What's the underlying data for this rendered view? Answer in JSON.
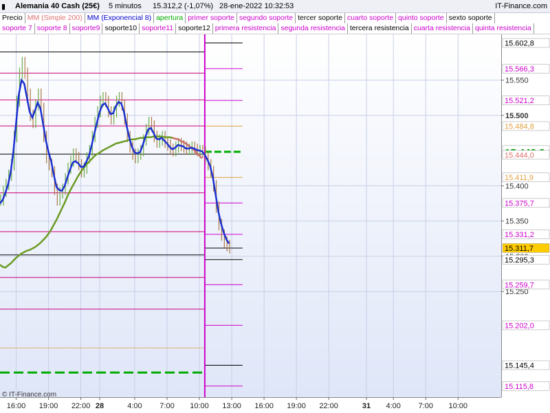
{
  "title_bar": {
    "instrument": "Alemania 40 Cash (25€)",
    "timeframe": "5 minutos",
    "quote": "15.312,2 (-1,07%)",
    "datetime": "28-ene-2022 10:32:53",
    "brand": "IT-Finance.com"
  },
  "legend_row1": [
    {
      "label": "Precio",
      "color": "#000000"
    },
    {
      "label": "MM (Simple 200)",
      "color": "#e07070"
    },
    {
      "label": "MM (Exponencial 8)",
      "color": "#0000cc"
    },
    {
      "label": "apertura",
      "color": "#00aa00"
    },
    {
      "label": "primer soporte",
      "color": "#cc00cc"
    },
    {
      "label": "segundo soporte",
      "color": "#cc00cc"
    },
    {
      "label": "tercer soporte",
      "color": "#000000"
    },
    {
      "label": "cuarto soporte",
      "color": "#cc00cc"
    },
    {
      "label": "quinto soporte",
      "color": "#cc00cc"
    },
    {
      "label": "sexto soporte",
      "color": "#000000"
    }
  ],
  "legend_row2": [
    {
      "label": "soporte 7",
      "color": "#cc00cc"
    },
    {
      "label": "soporte 8",
      "color": "#cc00cc"
    },
    {
      "label": "soporte9",
      "color": "#cc00cc"
    },
    {
      "label": "soporte10",
      "color": "#000000"
    },
    {
      "label": "soporte11",
      "color": "#cc00cc"
    },
    {
      "label": "soporte12",
      "color": "#000000"
    },
    {
      "label": "primera resistencia",
      "color": "#cc00cc"
    },
    {
      "label": "segunda resistencia",
      "color": "#cc00cc"
    },
    {
      "label": "tercera resistencia",
      "color": "#000000"
    },
    {
      "label": "cuarta resistencia",
      "color": "#cc00cc"
    },
    {
      "label": "quinta resistencia",
      "color": "#cc00cc"
    }
  ],
  "credit": "© IT-Finance.com",
  "chart_data": {
    "type": "line",
    "ylim": [
      15100,
      15615
    ],
    "y_ticks": [
      "15.550",
      "15.500",
      "15.400",
      "15.350",
      "15.300",
      "15.250"
    ],
    "x_ticks": [
      {
        "label": "16:00",
        "bar": 6
      },
      {
        "label": "19:00",
        "bar": 18
      },
      {
        "label": "22:00",
        "bar": 30
      },
      {
        "label": "28",
        "bar": 37,
        "bold": true
      },
      {
        "label": "4:00",
        "bar": 50
      },
      {
        "label": "7:00",
        "bar": 62
      },
      {
        "label": "10:00",
        "bar": 74
      },
      {
        "label": "13:00",
        "bar": 86
      },
      {
        "label": "16:00",
        "bar": 98
      },
      {
        "label": "19:00",
        "bar": 110
      },
      {
        "label": "22:00",
        "bar": 122
      },
      {
        "label": "31",
        "bar": 136,
        "bold": true
      },
      {
        "label": "4:00",
        "bar": 146
      },
      {
        "label": "7:00",
        "bar": 158
      },
      {
        "label": "10:00",
        "bar": 170
      }
    ],
    "bars_total": 186,
    "session_break_bar": 76,
    "last_price": 15311.7,
    "price_series": [
      15380,
      15392,
      15402,
      15415,
      15430,
      15470,
      15520,
      15560,
      15575,
      15560,
      15530,
      15500,
      15490,
      15515,
      15530,
      15510,
      15470,
      15440,
      15430,
      15420,
      15395,
      15380,
      15390,
      15395,
      15410,
      15425,
      15435,
      15445,
      15440,
      15430,
      15420,
      15425,
      15440,
      15450,
      15470,
      15490,
      15505,
      15520,
      15525,
      15520,
      15505,
      15495,
      15505,
      15520,
      15525,
      15515,
      15495,
      15470,
      15455,
      15445,
      15440,
      15445,
      15450,
      15465,
      15480,
      15490,
      15485,
      15470,
      15462,
      15465,
      15470,
      15462,
      15458,
      15452,
      15450,
      15455,
      15460,
      15457,
      15455,
      15452,
      15452,
      15455,
      15452,
      15450,
      15450,
      15448,
      15440,
      15430,
      15420,
      15400,
      15370,
      15345,
      15330,
      15320,
      15315,
      15312
    ],
    "ema8_series": [
      15375,
      15380,
      15390,
      15402,
      15420,
      15450,
      15490,
      15530,
      15550,
      15545,
      15525,
      15505,
      15497,
      15507,
      15518,
      15510,
      15488,
      15465,
      15448,
      15435,
      15415,
      15398,
      15394,
      15393,
      15400,
      15412,
      15423,
      15433,
      15435,
      15432,
      15427,
      15427,
      15434,
      15442,
      15457,
      15474,
      15490,
      15505,
      15515,
      15517,
      15510,
      15502,
      15503,
      15513,
      15519,
      15517,
      15505,
      15485,
      15468,
      15455,
      15447,
      15446,
      15448,
      15458,
      15470,
      15480,
      15482,
      15475,
      15467,
      15466,
      15468,
      15464,
      15460,
      15455,
      15452,
      15454,
      15458,
      15457,
      15456,
      15453,
      15453,
      15454,
      15453,
      15451,
      15450,
      15449,
      15444,
      15437,
      15428,
      15412,
      15388,
      15364,
      15347,
      15334,
      15324,
      15318
    ],
    "sma200_series": [
      15288,
      15285,
      15284,
      15287,
      15290,
      15294,
      15298,
      15301,
      15304,
      15306,
      15308,
      15309,
      15311,
      15313,
      15316,
      15319,
      15323,
      15327,
      15332,
      15338,
      15345,
      15352,
      15360,
      15368,
      15376,
      15385,
      15393,
      15400,
      15407,
      15414,
      15420,
      15425,
      15430,
      15434,
      15438,
      15442,
      15445,
      15447,
      15450,
      15452,
      15454,
      15456,
      15458,
      15460,
      15461,
      15462,
      15463,
      15464,
      15465,
      15466,
      15466,
      15467,
      15468,
      15468,
      15469,
      15469,
      15469,
      15470,
      15470,
      15470,
      15470,
      15469,
      15469,
      15469,
      15468,
      15467,
      15466,
      15464,
      15462,
      15460,
      15457,
      15454,
      15451,
      15447,
      15443,
      15439
    ],
    "levels_prev": [
      {
        "value": 15590,
        "color": "#000000",
        "dash": false
      },
      {
        "value": 15560,
        "color": "#cc0077",
        "dash": false
      },
      {
        "value": 15522,
        "color": "#cc0077",
        "dash": false
      },
      {
        "value": 15485,
        "color": "#cc0077",
        "dash": false
      },
      {
        "value": 15445,
        "color": "#000000",
        "dash": false
      },
      {
        "value": 15390,
        "color": "#cc0077",
        "dash": false
      },
      {
        "value": 15335,
        "color": "#cc0077",
        "dash": false
      },
      {
        "value": 15302,
        "color": "#000000",
        "dash": false
      },
      {
        "value": 15270,
        "color": "#cc0077",
        "dash": false
      },
      {
        "value": 15225,
        "color": "#cc0077",
        "dash": false
      },
      {
        "value": 15170,
        "color": "#e0b070",
        "dash": false
      },
      {
        "value": 15135,
        "color": "#00aa00",
        "dash": true
      }
    ],
    "levels_right": [
      {
        "value": 15602.8,
        "label": "15.602,8",
        "color": "#000000",
        "bg": "#ffffff"
      },
      {
        "value": 15566.3,
        "label": "15.566,3",
        "color": "#cc00cc",
        "bg": "#ffffff"
      },
      {
        "value": 15521.2,
        "label": "15.521,2",
        "color": "#cc00cc",
        "bg": "#ffffff"
      },
      {
        "value": 15484.8,
        "label": "15.484,8",
        "color": "#e0a040",
        "bg": "#ffffff"
      },
      {
        "value": 15448.3,
        "label": "15.448,3",
        "color": "#00aa00",
        "bg": "#ffffff",
        "big": true
      },
      {
        "value": 15444.0,
        "label": "15.444,0",
        "color": "#e07070",
        "bg": "#ffffff"
      },
      {
        "value": 15411.9,
        "label": "15.411,9",
        "color": "#e0a040",
        "bg": "#ffffff"
      },
      {
        "value": 15375.7,
        "label": "15.375,7",
        "color": "#cc00cc",
        "bg": "#ffffff"
      },
      {
        "value": 15331.2,
        "label": "15.331,2",
        "color": "#cc00cc",
        "bg": "#ffffff"
      },
      {
        "value": 15311.7,
        "label": "15.311,7",
        "color": "#000000",
        "bg": "#ffcc00"
      },
      {
        "value": 15295.3,
        "label": "15.295,3",
        "color": "#000000",
        "bg": "#ffffff"
      },
      {
        "value": 15259.7,
        "label": "15.259,7",
        "color": "#cc00cc",
        "bg": "#ffffff"
      },
      {
        "value": 15202.0,
        "label": "15.202,0",
        "color": "#cc00cc",
        "bg": "#ffffff"
      },
      {
        "value": 15145.4,
        "label": "15.145,4",
        "color": "#000000",
        "bg": "#ffffff"
      },
      {
        "value": 15115.8,
        "label": "15.115,8",
        "color": "#cc00cc",
        "bg": "#ffffff"
      }
    ]
  }
}
